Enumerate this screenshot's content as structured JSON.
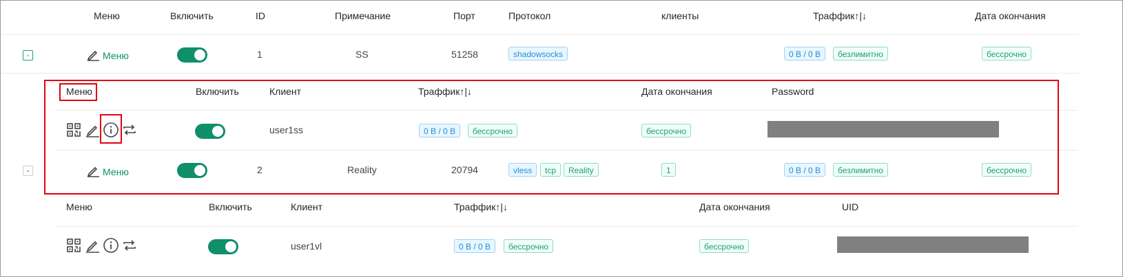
{
  "colors": {
    "accent": "#0f8f6a",
    "tag_blue": "#1f8fd8",
    "tag_green": "#1aa07a",
    "highlight": "#e2000f",
    "mask": "#808080"
  },
  "header": {
    "menu": "Меню",
    "enable": "Включить",
    "id": "ID",
    "remark": "Примечание",
    "port": "Порт",
    "protocol": "Протокол",
    "clients": "клиенты",
    "traffic": "Траффик↑|↓",
    "expiry": "Дата окончания"
  },
  "inbounds": [
    {
      "expander": "-",
      "menu_label": "Меню",
      "id": "1",
      "remark": "SS",
      "port": "51258",
      "protocol_tags": [
        "shadowsocks"
      ],
      "clients_count": "",
      "traffic": "0 B / 0 B",
      "traffic_limit": "безлимитно",
      "expiry": "бессрочно",
      "sub_header": {
        "menu": "Меню",
        "enable": "Включить",
        "client": "Клиент",
        "traffic": "Траффик↑|↓",
        "expiry": "Дата окончания",
        "credential": "Password"
      },
      "client": {
        "name": "user1ss",
        "traffic": "0 B / 0 B",
        "traffic_limit": "бессрочно",
        "expiry": "бессрочно"
      }
    },
    {
      "expander": "-",
      "menu_label": "Меню",
      "id": "2",
      "remark": "Reality",
      "port": "20794",
      "protocol_tags": [
        "vless",
        "tcp",
        "Reality"
      ],
      "clients_count": "1",
      "traffic": "0 B / 0 B",
      "traffic_limit": "безлимитно",
      "expiry": "бессрочно",
      "sub_header": {
        "menu": "Меню",
        "enable": "Включить",
        "client": "Клиент",
        "traffic": "Траффик↑|↓",
        "expiry": "Дата окончания",
        "credential": "UID"
      },
      "client": {
        "name": "user1vl",
        "traffic": "0 B / 0 B",
        "traffic_limit": "бессрочно",
        "expiry": "бессрочно"
      }
    }
  ],
  "icons": {
    "qr": "qr-code-icon",
    "edit": "pencil-icon",
    "info": "info-circle-icon",
    "reset": "reset-traffic-icon"
  }
}
